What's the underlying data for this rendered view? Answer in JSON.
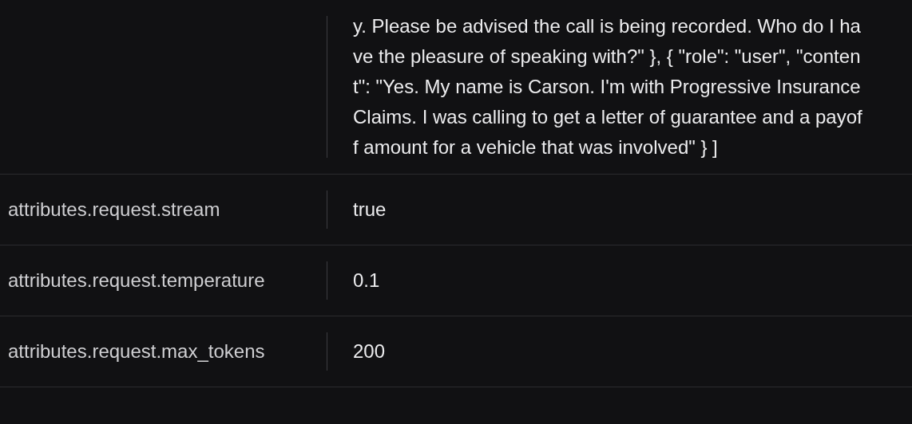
{
  "attributes": [
    {
      "value": "y. Please be advised the call is being recorded. Who do I have the pleasure of speaking with?\" }, { \"role\": \"user\", \"content\": \"Yes. My name is Carson. I'm with Progressive Insurance Claims. I was calling to get a letter of guarantee and a payoff amount for a vehicle that was involved\" } ]"
    },
    {
      "key": "attributes.request.stream",
      "value": "true"
    },
    {
      "key": "attributes.request.temperature",
      "value": "0.1"
    },
    {
      "key": "attributes.request.max_tokens",
      "value": "200"
    }
  ]
}
